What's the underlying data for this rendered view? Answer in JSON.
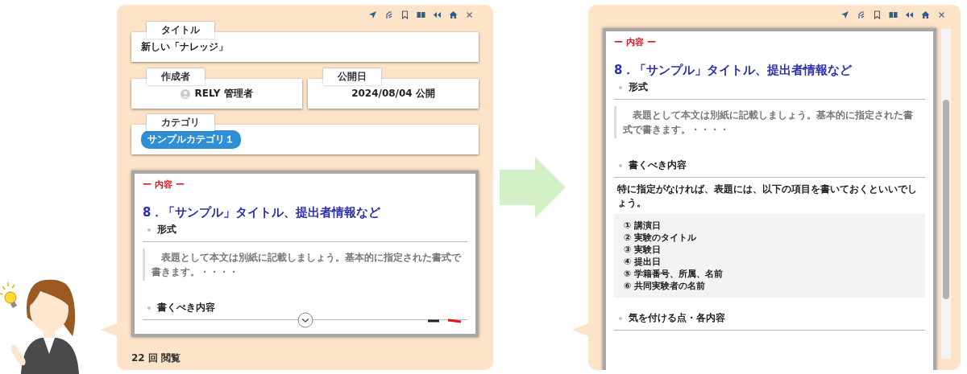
{
  "left_panel": {
    "title_field": {
      "label": "タイトル",
      "value": "新しい「ナレッジ」"
    },
    "author_field": {
      "label": "作成者",
      "value": "RELY 管理者"
    },
    "date_field": {
      "label": "公開日",
      "value": "2024/08/04 公開"
    },
    "category_field": {
      "label": "カテゴリ",
      "tags": [
        "サンプルカテゴリ１"
      ]
    },
    "content": {
      "section_label": "ー 内容 ー",
      "heading": "8．「サンプル」タイトル、提出者情報など",
      "blocks": [
        {
          "kind": "subheading",
          "text": "形式"
        },
        {
          "kind": "quote",
          "text": "表題として本文は別紙に記載しましょう。基本的に指定された書式で書きます。・・・・"
        },
        {
          "kind": "subheading",
          "text": "書くべき内容"
        }
      ]
    },
    "views": "22 回 閲覧"
  },
  "right_panel": {
    "content": {
      "section_label": "ー 内容 ー",
      "heading": "8．「サンプル」タイトル、提出者情報など",
      "blocks": [
        {
          "kind": "subheading",
          "text": "形式"
        },
        {
          "kind": "quote",
          "text": "表題として本文は別紙に記載しましょう。基本的に指定された書式で書きます。・・・・"
        },
        {
          "kind": "subheading",
          "text": "書くべき内容"
        },
        {
          "kind": "paragraph",
          "text": "特に指定がなければ、表題には、以下の項目を書いておくといいでしょう。"
        },
        {
          "kind": "list",
          "items": [
            "① 講演日",
            "② 実験のタイトル",
            "③ 実験日",
            "④ 提出日",
            "⑤ 学籍番号、所属、名前",
            "⑥ 共同実験者の名前"
          ]
        },
        {
          "kind": "subheading",
          "text": "気を付ける点・各内容"
        }
      ]
    }
  }
}
